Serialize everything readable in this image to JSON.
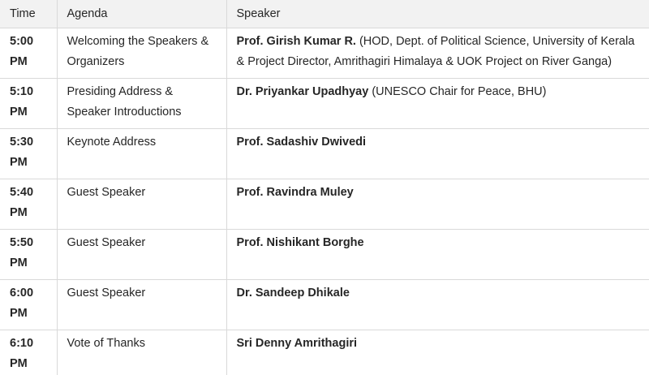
{
  "header": {
    "time": "Time",
    "agenda": "Agenda",
    "speaker": "Speaker"
  },
  "rows": [
    {
      "time": "5:00 PM",
      "agenda": "Welcoming the Speakers & Organizers",
      "speaker_name": "Prof. Girish Kumar R.",
      "speaker_detail": " (HOD, Dept. of Political Science, University of Kerala & Project Director, Amrithagiri Himalaya & UOK Project on River Ganga)"
    },
    {
      "time": "5:10 PM",
      "agenda": "Presiding Address & Speaker Introductions",
      "speaker_name": "Dr. Priyankar Upadhyay",
      "speaker_detail": " (UNESCO Chair for Peace, BHU)"
    },
    {
      "time": "5:30 PM",
      "agenda": "Keynote Address",
      "speaker_name": "Prof. Sadashiv Dwivedi",
      "speaker_detail": ""
    },
    {
      "time": "5:40 PM",
      "agenda": "Guest Speaker",
      "speaker_name": "Prof. Ravindra Muley",
      "speaker_detail": ""
    },
    {
      "time": "5:50 PM",
      "agenda": "Guest Speaker",
      "speaker_name": "Prof. Nishikant Borghe",
      "speaker_detail": ""
    },
    {
      "time": "6:00 PM",
      "agenda": "Guest Speaker",
      "speaker_name": "Dr. Sandeep Dhikale",
      "speaker_detail": ""
    },
    {
      "time": "6:10 PM",
      "agenda": "Vote of Thanks",
      "speaker_name": "Sri Denny Amrithagiri",
      "speaker_detail": ""
    }
  ]
}
